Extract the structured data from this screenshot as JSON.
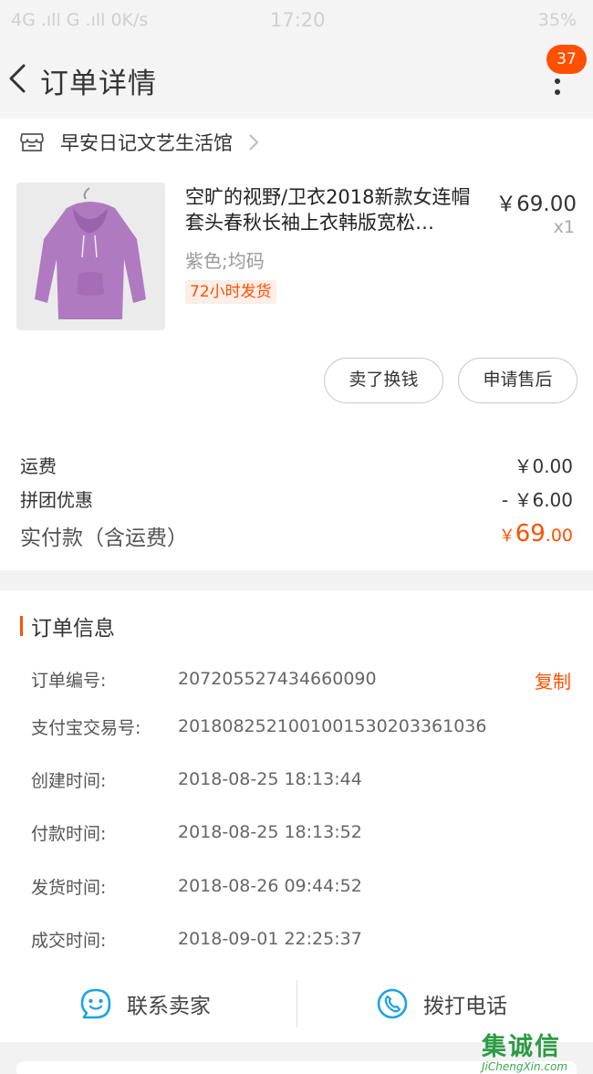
{
  "status_bar": {
    "left": "4G .ıll G .ıll 0K/s",
    "time": "17:20",
    "right": "35%"
  },
  "nav": {
    "title": "订单详情",
    "badge": "37"
  },
  "shop": {
    "name": "早安日记文艺生活馆"
  },
  "product": {
    "title": "空旷的视野/卫衣2018新款女连帽套头春秋长袖上衣韩版宽松…",
    "price": "￥69.00",
    "qty": "x1",
    "sku": "紫色;均码",
    "ship_tag": "72小时发货",
    "image_color": "#b07ac0"
  },
  "actions": {
    "sell_label": "卖了换钱",
    "after_sale_label": "申请售后"
  },
  "fees": {
    "shipping_label": "运费",
    "shipping_value": "￥0.00",
    "group_discount_label": "拼团优惠",
    "group_discount_value": "- ￥6.00",
    "total_label": "实付款（含运费）",
    "total_yen": "￥",
    "total_int": "69",
    "total_dec": ".00"
  },
  "order_info": {
    "title": "订单信息",
    "copy_label": "复制",
    "rows": [
      {
        "label": "订单编号:",
        "value": "207205527434660090"
      },
      {
        "label": "支付宝交易号:",
        "value": "2018082521001001530203361036"
      },
      {
        "label": "创建时间:",
        "value": "2018-08-25 18:13:44"
      },
      {
        "label": "付款时间:",
        "value": "2018-08-25 18:13:52"
      },
      {
        "label": "发货时间:",
        "value": "2018-08-26 09:44:52"
      },
      {
        "label": "成交时间:",
        "value": "2018-09-01 22:25:37"
      }
    ]
  },
  "contact": {
    "seller_label": "联系卖家",
    "phone_label": "拨打电话"
  },
  "watermark": {
    "logo": "集诚信",
    "url": "JiChengXin.com"
  },
  "colors": {
    "accent": "#ff5000",
    "icon_blue": "#1aa3e8"
  }
}
